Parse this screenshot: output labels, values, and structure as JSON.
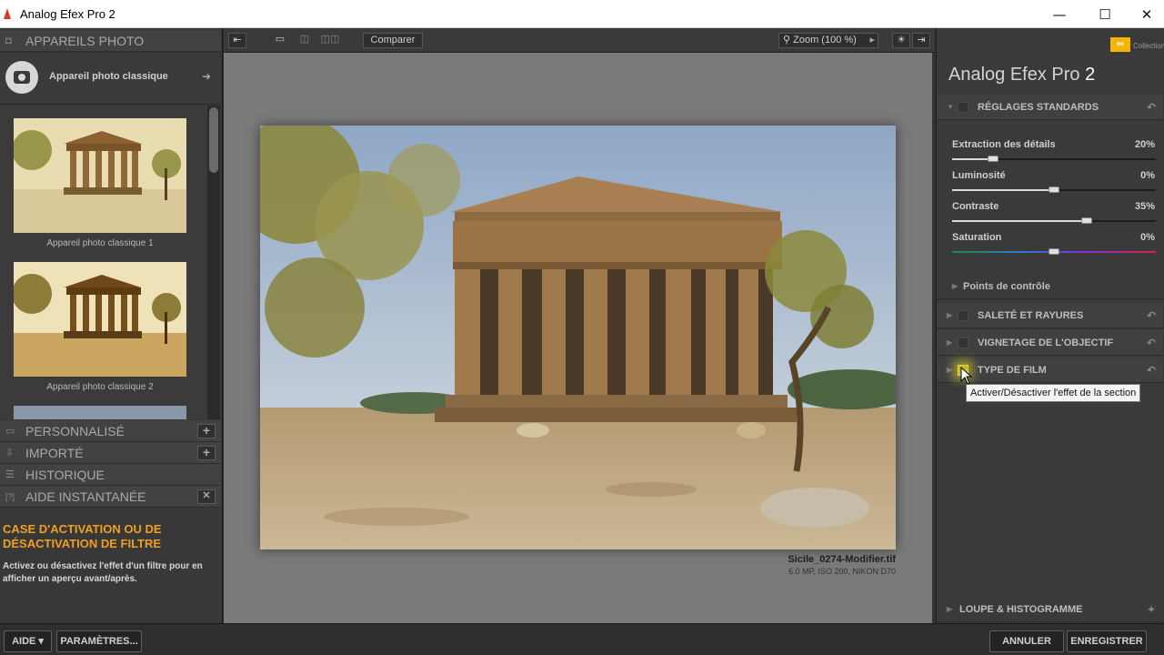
{
  "window": {
    "title": "Analog Efex Pro 2",
    "minimize": "—",
    "maximize": "☐",
    "close": "✕"
  },
  "left": {
    "cameras_header": "APPAREILS PHOTO",
    "camera_name": "Appareil photo classique",
    "thumbs": [
      "Appareil photo classique 1",
      "Appareil photo classique 2"
    ],
    "sections": [
      {
        "label": "PERSONNALISÉ",
        "action": "+"
      },
      {
        "label": "IMPORTÉ",
        "action": "+"
      },
      {
        "label": "HISTORIQUE",
        "action": ""
      },
      {
        "label": "AIDE INSTANTANÉE",
        "action": "✕"
      }
    ],
    "help_title": "CASE D'ACTIVATION OU DE DÉSACTIVATION DE FILTRE",
    "help_text": "Activez ou désactivez l'effet d'un filtre pour en afficher un aperçu avant/après."
  },
  "toolbar": {
    "compare": "Comparer",
    "zoom": "Zoom (100 %)"
  },
  "canvas": {
    "filename": "Sicile_0274-Modifier.tif",
    "meta": "6.0 MP, ISO 200, NIKON D70"
  },
  "right": {
    "brand": "NIK",
    "collection": "Collection",
    "product": "Analog Efex Pro",
    "product_version": "2",
    "basic_header": "RÉGLAGES STANDARDS",
    "sliders": [
      {
        "label": "Extraction des détails",
        "value": "20%",
        "level": 0.2
      },
      {
        "label": "Luminosité",
        "value": "0%",
        "level": 0.5
      },
      {
        "label": "Contraste",
        "value": "35%",
        "level": 0.66
      },
      {
        "label": "Saturation",
        "value": "0%",
        "level": 0.5
      }
    ],
    "control_points": "Points de contrôle",
    "sections": [
      "SALETÉ ET RAYURES",
      "VIGNETAGE DE L'OBJECTIF",
      "TYPE DE FILM"
    ],
    "tooltip": "Activer/Désactiver l'effet de la section",
    "loupe": "LOUPE & HISTOGRAMME"
  },
  "bottom": {
    "help": "AIDE ▾",
    "settings": "PARAMÈTRES...",
    "cancel": "ANNULER",
    "save": "ENREGISTRER"
  },
  "colors": {
    "accent": "#f0a020",
    "panel": "#3a3a3a",
    "canvas": "#7a7a7a"
  }
}
